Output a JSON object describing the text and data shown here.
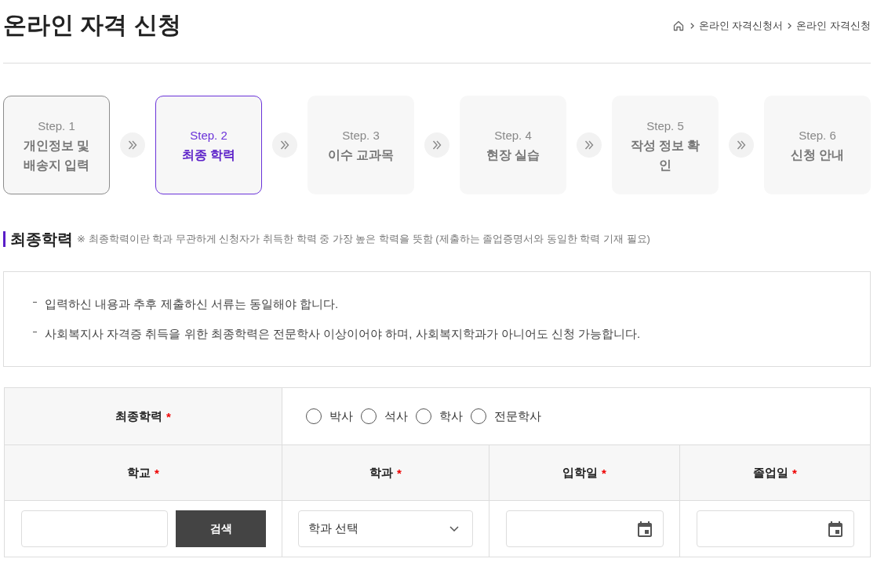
{
  "page": {
    "title": "온라인 자격 신청"
  },
  "breadcrumb": {
    "items": [
      "온라인 자격신청서",
      "온라인 자격신청"
    ]
  },
  "steps": [
    {
      "label": "Step. 1",
      "name": "개인정보 및 배송지 입력",
      "completed": true,
      "selected": false
    },
    {
      "label": "Step. 2",
      "name": "최종 학력",
      "completed": false,
      "selected": true
    },
    {
      "label": "Step. 3",
      "name": "이수 교과목",
      "completed": false,
      "selected": false
    },
    {
      "label": "Step. 4",
      "name": "현장 실습",
      "completed": false,
      "selected": false
    },
    {
      "label": "Step. 5",
      "name": "작성 정보 확인",
      "completed": false,
      "selected": false
    },
    {
      "label": "Step. 6",
      "name": "신청 안내",
      "completed": false,
      "selected": false
    }
  ],
  "section": {
    "title": "최종학력",
    "note": "※ 최종학력이란 학과 무관하게 신청자가 취득한 학력 중 가장 높은 학력을 뜻함 (제출하는 졸업증명서와 동일한 학력 기재 필요)"
  },
  "notices": [
    "입력하신 내용과 추후 제출하신 서류는 동일해야 합니다.",
    "사회복지사 자격증 취득을 위한 최종학력은 전문학사 이상이어야 하며, 사회복지학과가 아니어도 신청 가능합니다."
  ],
  "form": {
    "degree": {
      "label": "최종학력",
      "required_mark": "*",
      "options": [
        {
          "label": "박사",
          "selected": false
        },
        {
          "label": "석사",
          "selected": false
        },
        {
          "label": "학사",
          "selected": false
        },
        {
          "label": "전문학사",
          "selected": false
        }
      ]
    },
    "columns": [
      {
        "label": "학교",
        "required_mark": "*"
      },
      {
        "label": "학과",
        "required_mark": "*"
      },
      {
        "label": "입학일",
        "required_mark": "*"
      },
      {
        "label": "졸업일",
        "required_mark": "*"
      }
    ],
    "fields": [
      {
        "kind": "search",
        "button": "검색"
      },
      {
        "kind": "select",
        "value": "학과 선택"
      },
      {
        "kind": "date"
      },
      {
        "kind": "date"
      }
    ]
  }
}
